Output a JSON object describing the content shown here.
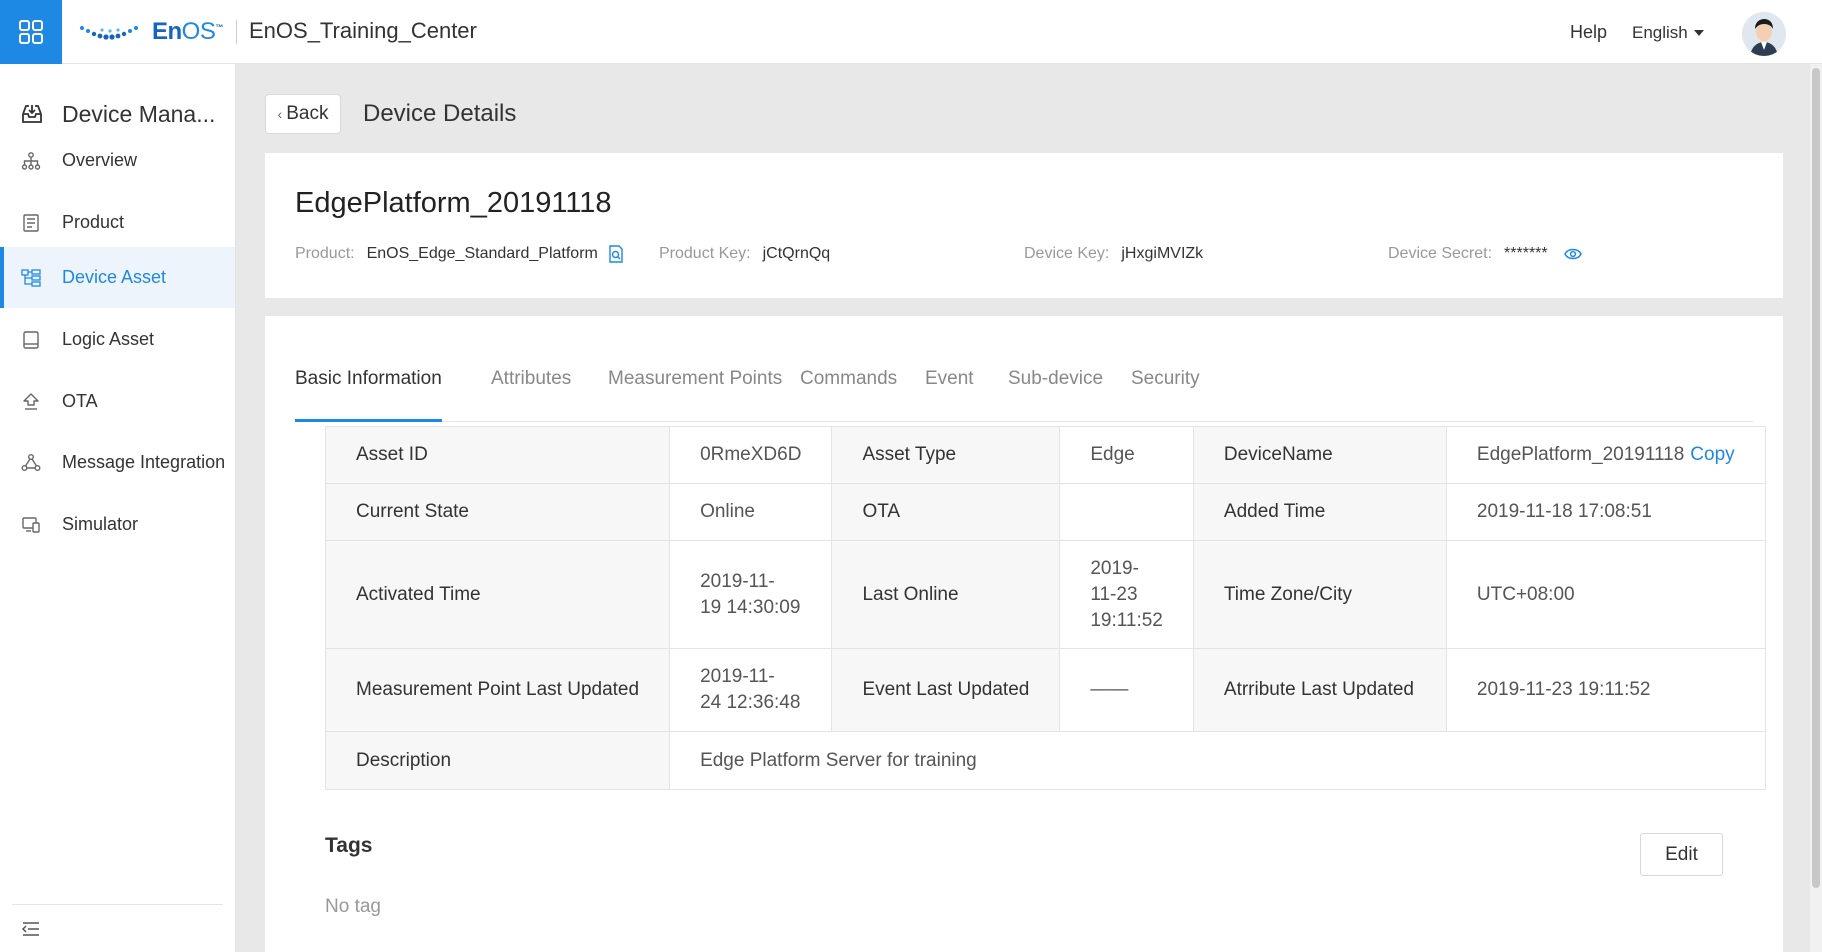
{
  "header": {
    "logo_text": "En",
    "logo_text_os": "OS",
    "logo_tm": "™",
    "app_title": "EnOS_Training_Center",
    "help": "Help",
    "language": "English",
    "brand_color": "#1e88e5"
  },
  "sidebar": {
    "module_title": "Device Mana...",
    "items": [
      {
        "label": "Overview",
        "icon": "hierarchy-icon"
      },
      {
        "label": "Product",
        "icon": "document-icon"
      },
      {
        "label": "Device Asset",
        "icon": "device-tree-icon",
        "active": true
      },
      {
        "label": "Logic Asset",
        "icon": "tablet-icon"
      },
      {
        "label": "OTA",
        "icon": "upload-icon"
      },
      {
        "label": "Message Integration",
        "icon": "share-icon"
      },
      {
        "label": "Simulator",
        "icon": "monitor-icon"
      }
    ]
  },
  "page": {
    "back_label": "Back",
    "title": "Device Details"
  },
  "device": {
    "name": "EdgePlatform_20191118",
    "product_label": "Product:",
    "product_value": "EnOS_Edge_Standard_Platform",
    "product_key_label": "Product Key:",
    "product_key_value": "jCtQrnQq",
    "device_key_label": "Device Key:",
    "device_key_value": "jHxgiMVIZk",
    "device_secret_label": "Device Secret:",
    "device_secret_value": "*******"
  },
  "tabs": [
    "Basic Information",
    "Attributes",
    "Measurement Points",
    "Commands",
    "Event",
    "Sub-device",
    "Security"
  ],
  "info": {
    "r1": {
      "k1": "Asset ID",
      "v1": "0RmeXD6D",
      "k2": "Asset Type",
      "v2": "Edge",
      "k3": "DeviceName",
      "v3": "EdgePlatform_20191118",
      "copy": "Copy"
    },
    "r2": {
      "k1": "Current State",
      "v1": "Online",
      "k2": "OTA",
      "v2": "",
      "k3": "Added Time",
      "v3": "2019-11-18 17:08:51"
    },
    "r3": {
      "k1": "Activated Time",
      "v1_a": "2019-11-",
      "v1_b": "19 14:30:09",
      "k2": "Last Online",
      "v2_a": "2019-",
      "v2_b": "11-23",
      "v2_c": "19:11:52",
      "k3": "Time Zone/City",
      "v3": "UTC+08:00"
    },
    "r4": {
      "k1": "Measurement Point Last Updated",
      "v1_a": "2019-11-",
      "v1_b": "24 12:36:48",
      "k2": "Event Last Updated",
      "v2": "——",
      "k3": "Atrribute Last Updated",
      "v3": "2019-11-23 19:11:52"
    },
    "r5": {
      "k1": "Description",
      "v1": "Edge Platform Server for training"
    }
  },
  "tags": {
    "title": "Tags",
    "edit": "Edit",
    "empty": "No tag"
  }
}
